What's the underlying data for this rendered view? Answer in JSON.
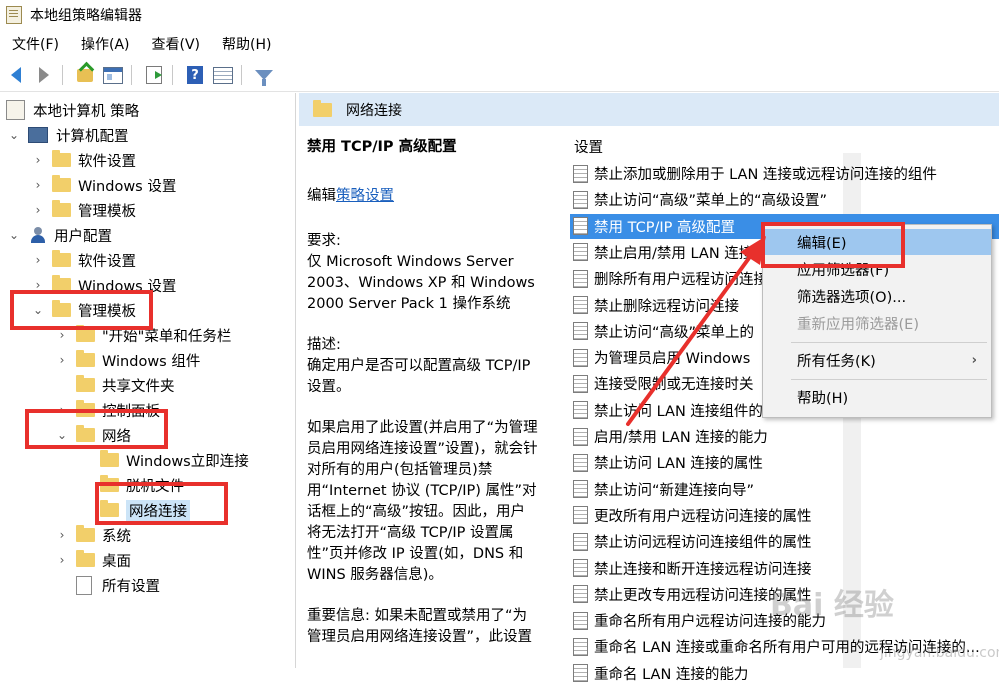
{
  "window": {
    "title": "本地组策略编辑器"
  },
  "menu": [
    "文件(F)",
    "操作(A)",
    "查看(V)",
    "帮助(H)"
  ],
  "toolbar": {
    "icons": [
      "back-arrow-icon",
      "forward-arrow-icon",
      "up-folder-icon",
      "show-hide-tree-icon",
      "export-list-icon",
      "help-icon",
      "view-icon",
      "filter-icon"
    ]
  },
  "tree": [
    {
      "label": "本地计算机 策略"
    },
    {
      "label": "计算机配置"
    },
    {
      "label": "软件设置"
    },
    {
      "label": "Windows 设置"
    },
    {
      "label": "管理模板"
    },
    {
      "label": "用户配置"
    },
    {
      "label": "软件设置"
    },
    {
      "label": "Windows 设置"
    },
    {
      "label": "管理模板"
    },
    {
      "label": "\"开始\"菜单和任务栏"
    },
    {
      "label": "Windows 组件"
    },
    {
      "label": "共享文件夹"
    },
    {
      "label": "控制面板"
    },
    {
      "label": "网络"
    },
    {
      "label": "Windows立即连接"
    },
    {
      "label": "脱机文件"
    },
    {
      "label": "网络连接"
    },
    {
      "label": "系统"
    },
    {
      "label": "桌面"
    },
    {
      "label": "所有设置"
    }
  ],
  "right": {
    "header": "网络连接",
    "detail": {
      "title": "禁用 TCP/IP 高级配置",
      "edit_prefix": "编辑",
      "edit_link": "策略设置",
      "req_label": "要求:",
      "req_text": "仅 Microsoft Windows Server 2003、Windows XP 和 Windows 2000 Server Pack 1 操作系统",
      "desc_label": "描述:",
      "desc_text": "确定用户是否可以配置高级 TCP/IP 设置。",
      "body_text": "如果启用了此设置(并启用了“为管理员启用网络连接设置”设置)，就会针对所有的用户(包括管理员)禁用“Internet 协议 (TCP/IP) 属性”对话框上的“高级”按钮。因此，用户将无法打开“高级 TCP/IP 设置属性”页并修改 IP 设置(如，DNS 和 WINS 服务器信息)。",
      "important_text": "重要信息: 如果未配置或禁用了“为管理员启用网络连接设置”，此设置"
    },
    "column_header": "设置",
    "settings": [
      "禁止添加或删除用于 LAN 连接或远程访问连接的组件",
      "禁止访问“高级”菜单上的“高级设置”",
      "禁用 TCP/IP 高级配置",
      "禁止启用/禁用 LAN 连接",
      "删除所有用户远程访问连接",
      "禁止删除远程访问连接",
      "禁止访问“高级”菜单上的",
      "为管理员启用 Windows",
      "连接受限制或无连接时关",
      "禁止访问 LAN 连接组件的属性",
      "启用/禁用 LAN 连接的能力",
      "禁止访问 LAN 连接的属性",
      "禁止访问“新建连接向导”",
      "更改所有用户远程访问连接的属性",
      "禁止访问远程访问连接组件的属性",
      "禁止连接和断开连接远程访问连接",
      "禁止更改专用远程访问连接的属性",
      "重命名所有用户远程访问连接的能力",
      "重命名 LAN 连接或重命名所有用户可用的远程访问连接的...",
      "重命名 LAN 连接的能力"
    ]
  },
  "context_menu": {
    "items": [
      "编辑(E)",
      "应用筛选器(F)",
      "筛选器选项(O)...",
      "重新应用筛选器(E)",
      "所有任务(K)",
      "帮助(H)"
    ]
  },
  "watermark": {
    "main": "Bai 经验",
    "sub": "jingyan.baidu.com"
  },
  "colors": {
    "highlight": "#3a8ee6",
    "annotation_red": "#e8302c",
    "header_bg": "#dbe9f7"
  }
}
